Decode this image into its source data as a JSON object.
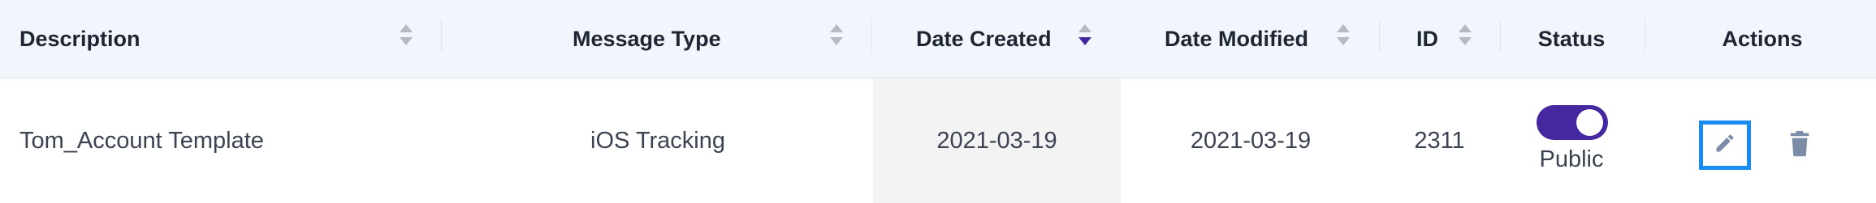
{
  "columns": {
    "description": "Description",
    "message_type": "Message Type",
    "date_created": "Date Created",
    "date_modified": "Date Modified",
    "id": "ID",
    "status": "Status",
    "actions": "Actions"
  },
  "sort": {
    "active_column": "date_created",
    "direction": "descending"
  },
  "row": {
    "description": "Tom_Account Template",
    "message_type": "iOS Tracking",
    "date_created": "2021-03-19",
    "date_modified": "2021-03-19",
    "id": "2311",
    "status_toggle_on": true,
    "status_label": "Public"
  },
  "icons": {
    "edit": "pencil-icon",
    "delete": "trash-icon",
    "sort": "sort-arrows-icon"
  },
  "colors": {
    "header_bg": "#f1f5fc",
    "toggle_on": "#4527a0",
    "active_sort_arrow": "#4527a0",
    "inactive_sort_arrow": "#b4b9c2",
    "focus_outline": "#1a8cf0",
    "action_icon": "#7d8ca6",
    "sorted_column_bg": "#f3f3f4"
  }
}
